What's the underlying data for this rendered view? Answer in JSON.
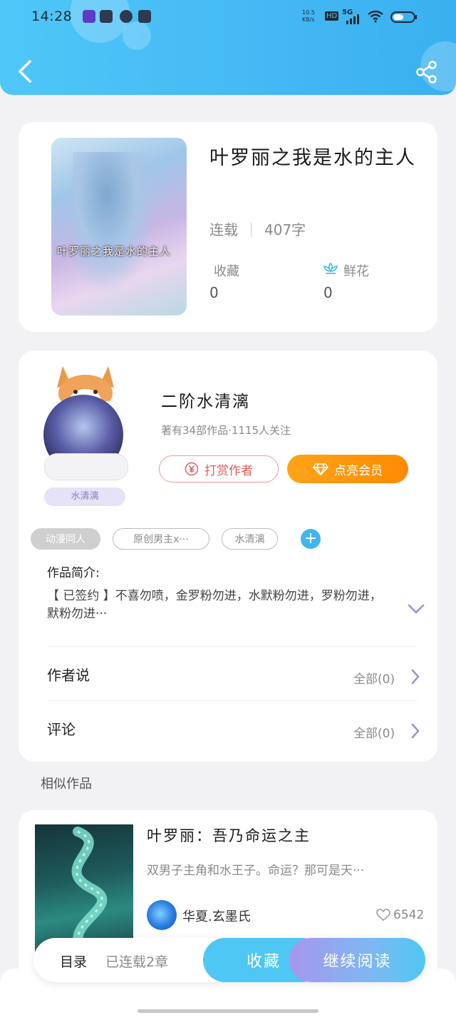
{
  "status_bar": {
    "time": "14:28",
    "net_speed": "10.5 KB/s",
    "hd": "HD",
    "signal": "5G"
  },
  "book": {
    "title": "叶罗丽之我是水的主人",
    "cover_text": "叶罗丽之我是水的主人",
    "state": "连载",
    "word_count": "407字",
    "favorites_label": "收藏",
    "favorites_value": "0",
    "flowers_label": "鲜花",
    "flowers_value": "0"
  },
  "author": {
    "name": "二阶水清漓",
    "badge": "水清漓",
    "meta": "著有34部作品·1115人关注",
    "tip_label": "打赏作者",
    "vip_label": "点亮会员"
  },
  "tags": [
    "动漫同人",
    "原创男主x···",
    "水清漓"
  ],
  "intro": {
    "title": "作品简介:",
    "text": "【 已签约 】不喜勿喷，金罗粉勿进，水默粉勿进，罗粉勿进，默粉勿进···"
  },
  "rows": {
    "author_says_label": "作者说",
    "author_says_count": "全部(0)",
    "comments_label": "评论",
    "comments_count": "全部(0)"
  },
  "similar": {
    "section_title": "相似作品",
    "title": "叶罗丽：吾乃命运之主",
    "desc": "双男子主角和水王子。命运？那可是天···",
    "author": "华夏.玄墨氏",
    "likes": "6542"
  },
  "bottom_bar": {
    "toc_label": "目录",
    "chapters": "已连载2章",
    "favorite_label": "收藏",
    "read_label": "继续阅读"
  },
  "colors": {
    "accent": "#44b8f4",
    "vip_orange": "#ff9a0e",
    "tip_red": "#e35c5c"
  }
}
